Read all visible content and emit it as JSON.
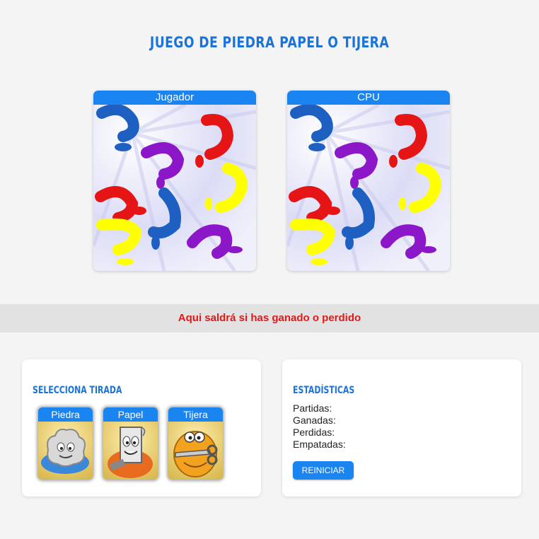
{
  "title": "JUEGO DE PIEDRA PAPEL O TIJERA",
  "players": {
    "player_label": "Jugador",
    "cpu_label": "CPU"
  },
  "result_message": "Aqui saldrá si has ganado o perdido",
  "selection": {
    "title": "SELECCIONA TIRADA",
    "options": [
      "Piedra",
      "Papel",
      "Tijera"
    ]
  },
  "stats": {
    "title": "ESTADÍSTICAS",
    "played_label": "Partidas:",
    "won_label": "Ganadas:",
    "lost_label": "Perdidas:",
    "tied_label": "Empatadas:",
    "reset_label": "REINICIAR"
  },
  "colors": {
    "accent": "#1a84f0",
    "title": "#1a73d9",
    "result": "#e01818"
  }
}
